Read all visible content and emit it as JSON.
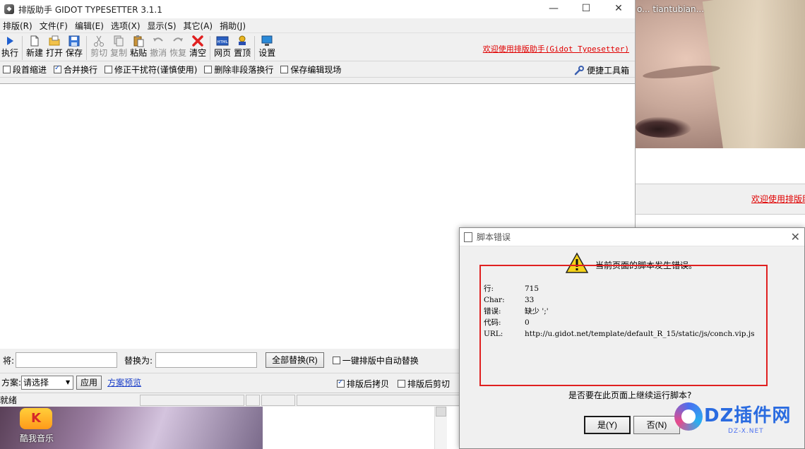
{
  "background": {
    "caption": "o...  tiantubian...",
    "welcome_text": "欢迎使用排版助"
  },
  "app": {
    "title": "排版助手 GIDOT TYPESETTER 3.1.1",
    "window_buttons": {
      "minimize": "—",
      "maximize": "☐",
      "close": "✕"
    },
    "menu": [
      "排版(R)",
      "文件(F)",
      "编辑(E)",
      "选项(X)",
      "显示(S)",
      "其它(A)",
      "捐助(J)"
    ],
    "toolbar": {
      "execute": "执行",
      "new": "新建",
      "open": "打开",
      "save": "保存",
      "cut": "剪切",
      "copy": "复制",
      "paste": "粘贴",
      "undo": "撤消",
      "redo": "恢复",
      "clear": "清空",
      "webpage": "网页",
      "top": "置顶",
      "settings": "设置"
    },
    "welcome_link": "欢迎使用排版助手(Gidot Typesetter)",
    "options": [
      {
        "label": "段首缩进",
        "checked": false
      },
      {
        "label": "合并换行",
        "checked": true
      },
      {
        "label": "修正干扰符(谨慎使用)",
        "checked": false
      },
      {
        "label": "删除非段落换行",
        "checked": false
      },
      {
        "label": "保存编辑现场",
        "checked": false
      }
    ],
    "quick_toolbox": "便捷工具箱",
    "replace": {
      "find_label": "将:",
      "find_value": "",
      "replace_label": "替换为:",
      "replace_value": "",
      "replace_all_button": "全部替换(R)",
      "auto_replace_label": "一键排版中自动替换",
      "auto_replace_checked": false
    },
    "scheme": {
      "label": "方案:",
      "selected": "请选择",
      "apply_button": "应用",
      "preview_link": "方案预览",
      "copy_after_label": "排版后拷贝",
      "copy_after_checked": true,
      "cut_after_label": "排版后剪切",
      "cut_after_checked": false
    },
    "status": "就绪"
  },
  "taskbar": {
    "kuwo_icon_text": "K",
    "kuwo_label": "酷我音乐"
  },
  "dialog": {
    "title": "脚本错误",
    "header": "当前页面的脚本发生错误。",
    "details": [
      {
        "key": "行:",
        "value": "715"
      },
      {
        "key": "Char:",
        "value": "33"
      },
      {
        "key": "错误:",
        "value": "缺少 ';'"
      },
      {
        "key": "代码:",
        "value": "0"
      },
      {
        "key": "URL:",
        "value": "http://u.gidot.net/template/default_R_15/static/js/conch.vip.js"
      }
    ],
    "question": "是否要在此页面上继续运行脚本?",
    "yes_button": "是(Y)",
    "no_button": "否(N)",
    "close": "✕"
  },
  "watermark": {
    "text": "DZ插件网",
    "sub": "DZ-X.NET"
  },
  "colors": {
    "error_red": "#e02020",
    "link_red": "#e00000",
    "link_blue": "#1a3ec8"
  }
}
